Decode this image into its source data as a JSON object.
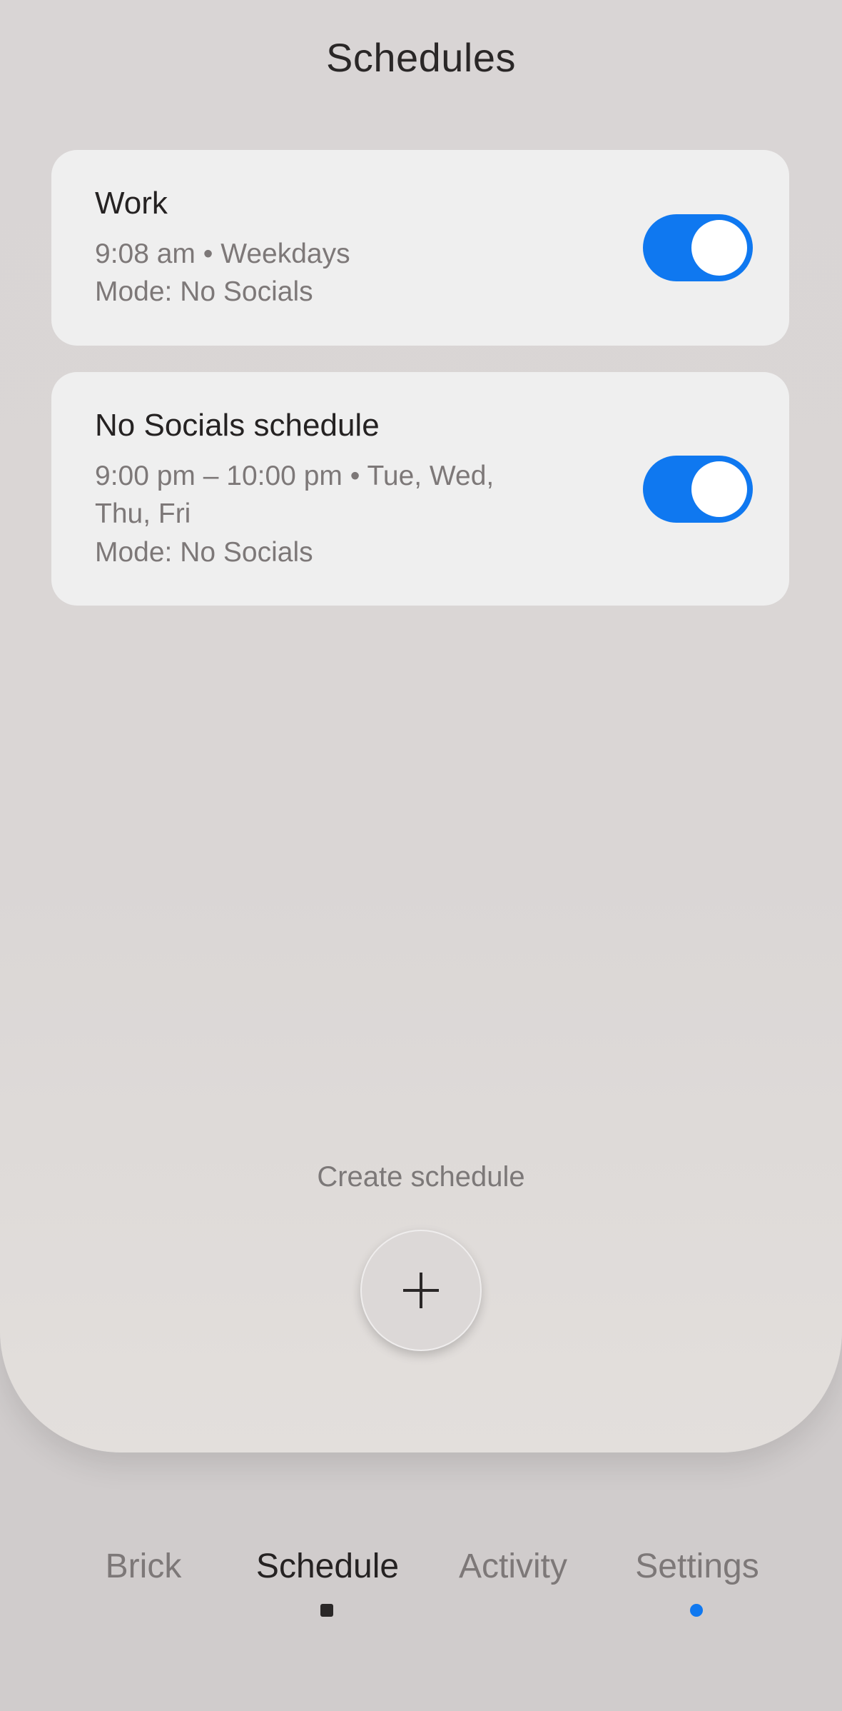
{
  "header": {
    "title": "Schedules"
  },
  "schedules": [
    {
      "title": "Work",
      "time_line": "9:08 am • Weekdays",
      "time_line_2": "",
      "mode_line": "Mode: No Socials",
      "enabled": true
    },
    {
      "title": "No Socials schedule",
      "time_line": "9:00 pm – 10:00 pm • Tue, Wed,",
      "time_line_2": "Thu, Fri",
      "mode_line": "Mode: No Socials",
      "enabled": true
    }
  ],
  "create": {
    "label": "Create schedule",
    "button_icon": "plus-icon"
  },
  "nav": {
    "items": [
      {
        "label": "Brick",
        "active": false
      },
      {
        "label": "Schedule",
        "active": true
      },
      {
        "label": "Activity",
        "active": false
      },
      {
        "label": "Settings",
        "active": false,
        "notification_dot": true
      }
    ]
  },
  "colors": {
    "accent": "#0f78f0",
    "background": "#d9d5d5",
    "card": "#efefef",
    "text_primary": "#252222",
    "text_secondary": "#7d7878"
  }
}
